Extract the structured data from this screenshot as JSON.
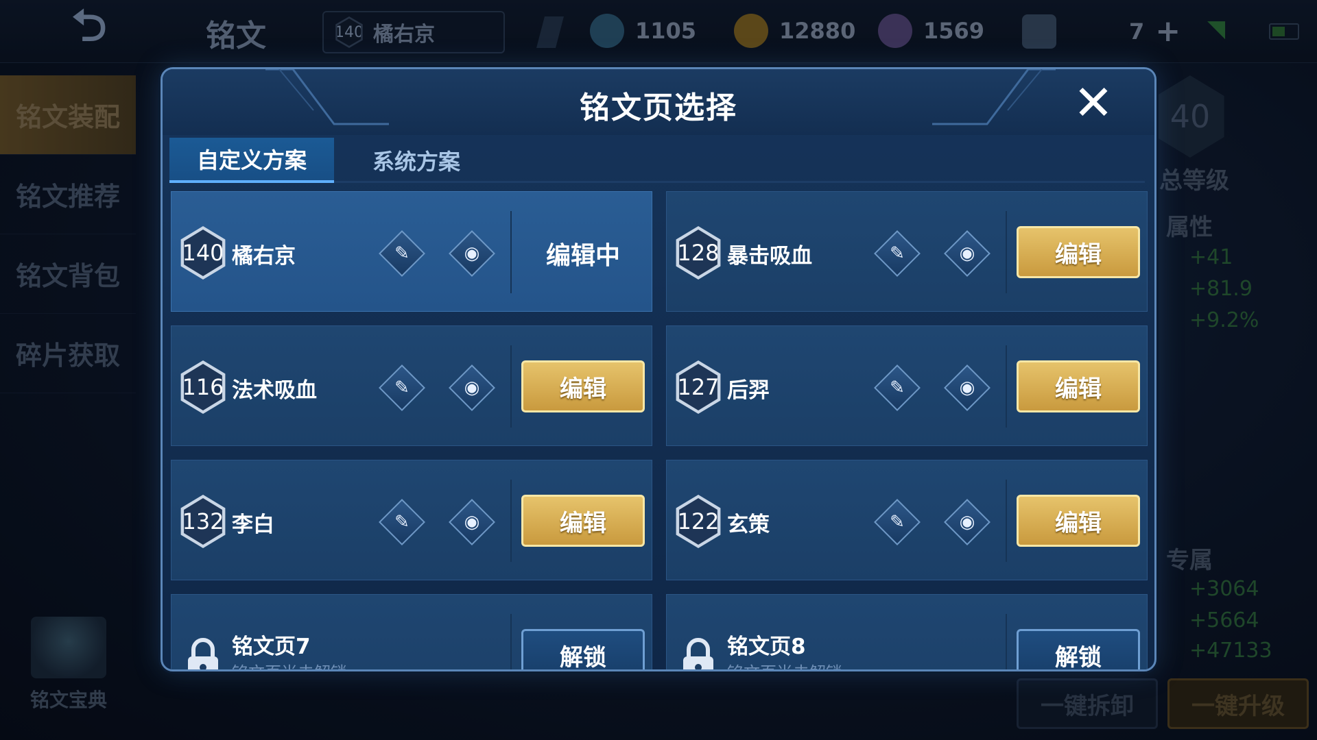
{
  "topbar": {
    "title": "铭文",
    "current_page": {
      "level": "140",
      "name": "橘右京"
    },
    "resources": [
      {
        "icon": "crystal-icon",
        "value": "1105",
        "color": "#4aa0c8"
      },
      {
        "icon": "gold-coin-icon",
        "value": "12880",
        "color": "#d8a227"
      },
      {
        "icon": "gem-icon",
        "value": "1569",
        "color": "#8a6bc6"
      },
      {
        "icon": "card-icon",
        "value": "7",
        "color": "#5f7fa0"
      }
    ]
  },
  "leftnav": {
    "items": [
      "铭文装配",
      "铭文推荐",
      "铭文背包",
      "碎片获取"
    ],
    "codex_label": "铭文宝典"
  },
  "rightpanel": {
    "level": "40",
    "total_level_label": "总等级",
    "attr_label": "属性",
    "attr_values": [
      "+41",
      "+81.9",
      "+9.2%"
    ],
    "exclusive_label": "专属",
    "exclusive_values": [
      "+3064",
      "+5664",
      "+47133"
    ]
  },
  "bottom_buttons": {
    "dismantle": "一键拆卸",
    "upgrade": "一键升级"
  },
  "modal": {
    "title": "铭文页选择",
    "close": "✕",
    "tabs": {
      "custom": "自定义方案",
      "system": "系统方案"
    },
    "editing_label": "编辑中",
    "edit_label": "编辑",
    "unlock_label": "解锁",
    "pages": [
      {
        "level": "140",
        "name": "橘右京",
        "current": true
      },
      {
        "level": "128",
        "name": "暴击吸血",
        "current": false
      },
      {
        "level": "116",
        "name": "法术吸血",
        "current": false
      },
      {
        "level": "127",
        "name": "后羿",
        "current": false
      },
      {
        "level": "132",
        "name": "李白",
        "current": false
      },
      {
        "level": "122",
        "name": "玄策",
        "current": false
      }
    ],
    "locked_pages": [
      {
        "name": "铭文页7",
        "sub": "铭文页尚未解锁"
      },
      {
        "name": "铭文页8",
        "sub": "铭文页尚未解锁"
      }
    ]
  }
}
